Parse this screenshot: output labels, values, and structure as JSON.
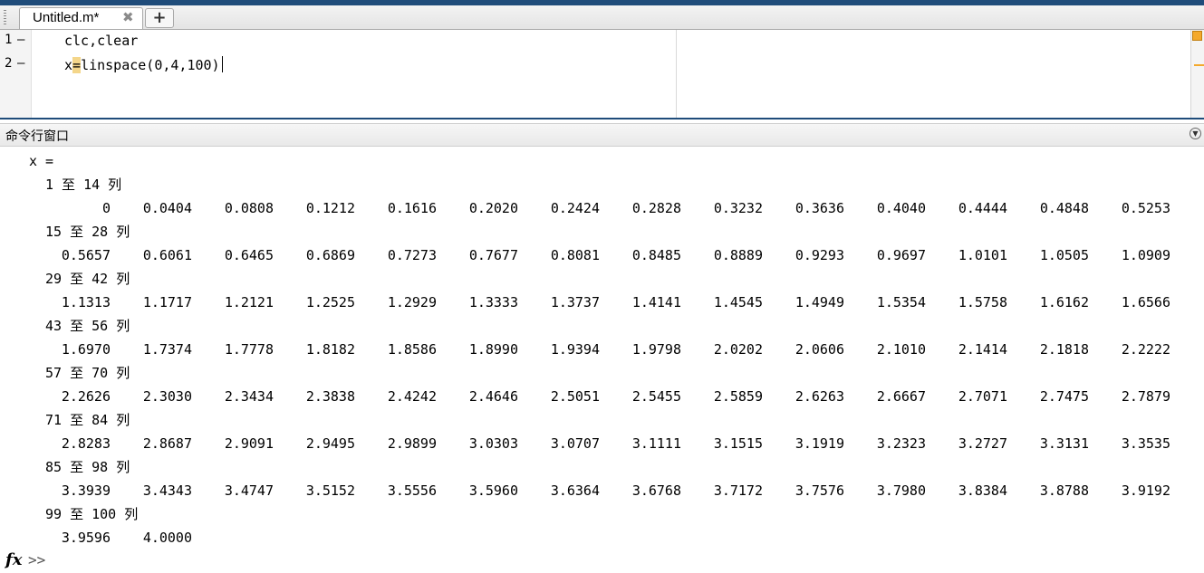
{
  "editor": {
    "tab_label": "Untitled.m*",
    "close_glyph": "✖",
    "add_glyph": "+",
    "lines": [
      {
        "number": "1",
        "dash": "—",
        "code_before": "clc,clear",
        "code_eq": "",
        "code_after": ""
      },
      {
        "number": "2",
        "dash": "—",
        "code_before": "x",
        "code_eq": "=",
        "code_after": "linspace(0,4,100)"
      }
    ]
  },
  "command_window": {
    "title": "命令行窗口",
    "var_header": "x =",
    "blocks": [
      {
        "label": "1 至 14 列",
        "values": [
          "0",
          "0.0404",
          "0.0808",
          "0.1212",
          "0.1616",
          "0.2020",
          "0.2424",
          "0.2828",
          "0.3232",
          "0.3636",
          "0.4040",
          "0.4444",
          "0.4848",
          "0.5253"
        ]
      },
      {
        "label": "15 至 28 列",
        "values": [
          "0.5657",
          "0.6061",
          "0.6465",
          "0.6869",
          "0.7273",
          "0.7677",
          "0.8081",
          "0.8485",
          "0.8889",
          "0.9293",
          "0.9697",
          "1.0101",
          "1.0505",
          "1.0909"
        ]
      },
      {
        "label": "29 至 42 列",
        "values": [
          "1.1313",
          "1.1717",
          "1.2121",
          "1.2525",
          "1.2929",
          "1.3333",
          "1.3737",
          "1.4141",
          "1.4545",
          "1.4949",
          "1.5354",
          "1.5758",
          "1.6162",
          "1.6566"
        ]
      },
      {
        "label": "43 至 56 列",
        "values": [
          "1.6970",
          "1.7374",
          "1.7778",
          "1.8182",
          "1.8586",
          "1.8990",
          "1.9394",
          "1.9798",
          "2.0202",
          "2.0606",
          "2.1010",
          "2.1414",
          "2.1818",
          "2.2222"
        ]
      },
      {
        "label": "57 至 70 列",
        "values": [
          "2.2626",
          "2.3030",
          "2.3434",
          "2.3838",
          "2.4242",
          "2.4646",
          "2.5051",
          "2.5455",
          "2.5859",
          "2.6263",
          "2.6667",
          "2.7071",
          "2.7475",
          "2.7879"
        ]
      },
      {
        "label": "71 至 84 列",
        "values": [
          "2.8283",
          "2.8687",
          "2.9091",
          "2.9495",
          "2.9899",
          "3.0303",
          "3.0707",
          "3.1111",
          "3.1515",
          "3.1919",
          "3.2323",
          "3.2727",
          "3.3131",
          "3.3535"
        ]
      },
      {
        "label": "85 至 98 列",
        "values": [
          "3.3939",
          "3.4343",
          "3.4747",
          "3.5152",
          "3.5556",
          "3.5960",
          "3.6364",
          "3.6768",
          "3.7172",
          "3.7576",
          "3.7980",
          "3.8384",
          "3.8788",
          "3.9192"
        ]
      },
      {
        "label": "99 至 100 列",
        "values": [
          "3.9596",
          "4.0000"
        ]
      }
    ],
    "prompt": ">>",
    "fx_label": "fx"
  },
  "colors": {
    "accent": "#1f4c7a",
    "warning": "#f4a92c",
    "highlight": "#f4d68a"
  }
}
